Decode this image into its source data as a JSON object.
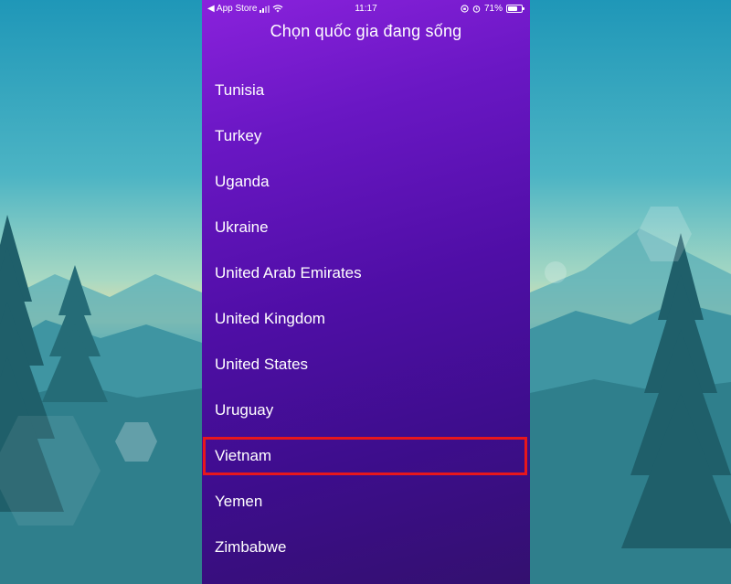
{
  "status_bar": {
    "back_app": "◀ App Store",
    "time": "11:17",
    "battery": "71%",
    "battery_level": 0.71
  },
  "page_title": "Chọn quốc gia đang sống",
  "countries": [
    "Tunisia",
    "Turkey",
    "Uganda",
    "Ukraine",
    "United Arab Emirates",
    "United Kingdom",
    "United States",
    "Uruguay",
    "Vietnam",
    "Yemen",
    "Zimbabwe"
  ],
  "highlighted_country": "Vietnam",
  "colors": {
    "screen_gradient_top": "#8a22dc",
    "screen_gradient_bottom": "#33106f",
    "highlight_border": "#e8171c",
    "text": "#ffffff"
  }
}
